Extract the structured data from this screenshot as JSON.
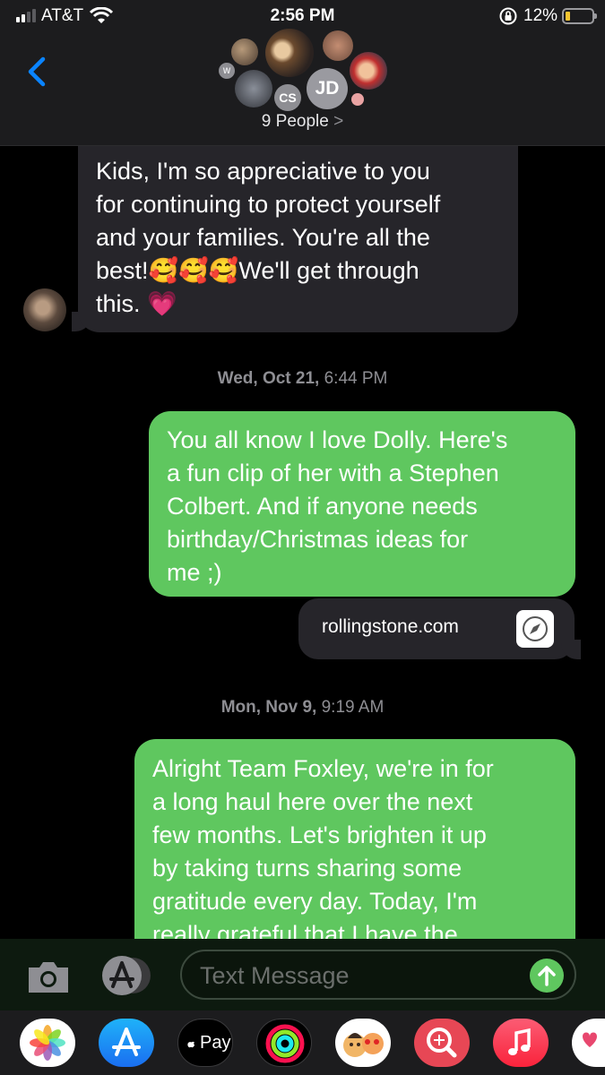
{
  "status_bar": {
    "carrier": "AT&T",
    "time": "2:56 PM",
    "battery_percent": "12%",
    "battery_level": 0.12,
    "signal_bars": 2
  },
  "header": {
    "back_icon": "chevron-left-icon",
    "group_label": "9 People",
    "group_chevron": ">",
    "avatar_initials": [
      "CS",
      "JD",
      "W"
    ]
  },
  "messages": [
    {
      "direction": "incoming",
      "lines": [
        "Kids, I'm so appreciative to you",
        "for continuing to protect yourself",
        "and your families. You're all the",
        "best!🥰🥰🥰We'll get through",
        "this. 💗"
      ]
    },
    {
      "timestamp_day": "Wed, Oct 21,",
      "timestamp_time": "6:44 PM"
    },
    {
      "direction": "outgoing",
      "lines": [
        "You all know I love Dolly. Here's",
        "a fun clip of her with a Stephen",
        "Colbert. And if anyone needs",
        "birthday/Christmas ideas for",
        "me ;)"
      ]
    },
    {
      "link_preview": "rollingstone.com",
      "link_icon": "compass-icon"
    },
    {
      "timestamp_day": "Mon, Nov 9,",
      "timestamp_time": "9:19 AM"
    },
    {
      "direction": "outgoing",
      "lines": [
        "Alright Team Foxley, we're in for",
        "a long haul here over the next",
        "few months. Let's brighten it up",
        "by taking turns sharing some",
        "gratitude every day. Today, I'm",
        "really grateful that I have the"
      ]
    }
  ],
  "input_bar": {
    "camera_icon": "camera-icon",
    "appstore_icon": "app-store-icon",
    "placeholder": "Text Message",
    "send_icon": "arrow-up-icon"
  },
  "app_drawer": {
    "apps": [
      "Photos",
      "App Store",
      "Pay",
      "Activity",
      "Memoji",
      "Search Images",
      "Music",
      "Hearts"
    ],
    "apple_pay_label": "Pay"
  },
  "colors": {
    "outgoing_bubble": "#5fc75f",
    "incoming_bubble": "#26252a",
    "accent_blue": "#0a84ff"
  }
}
